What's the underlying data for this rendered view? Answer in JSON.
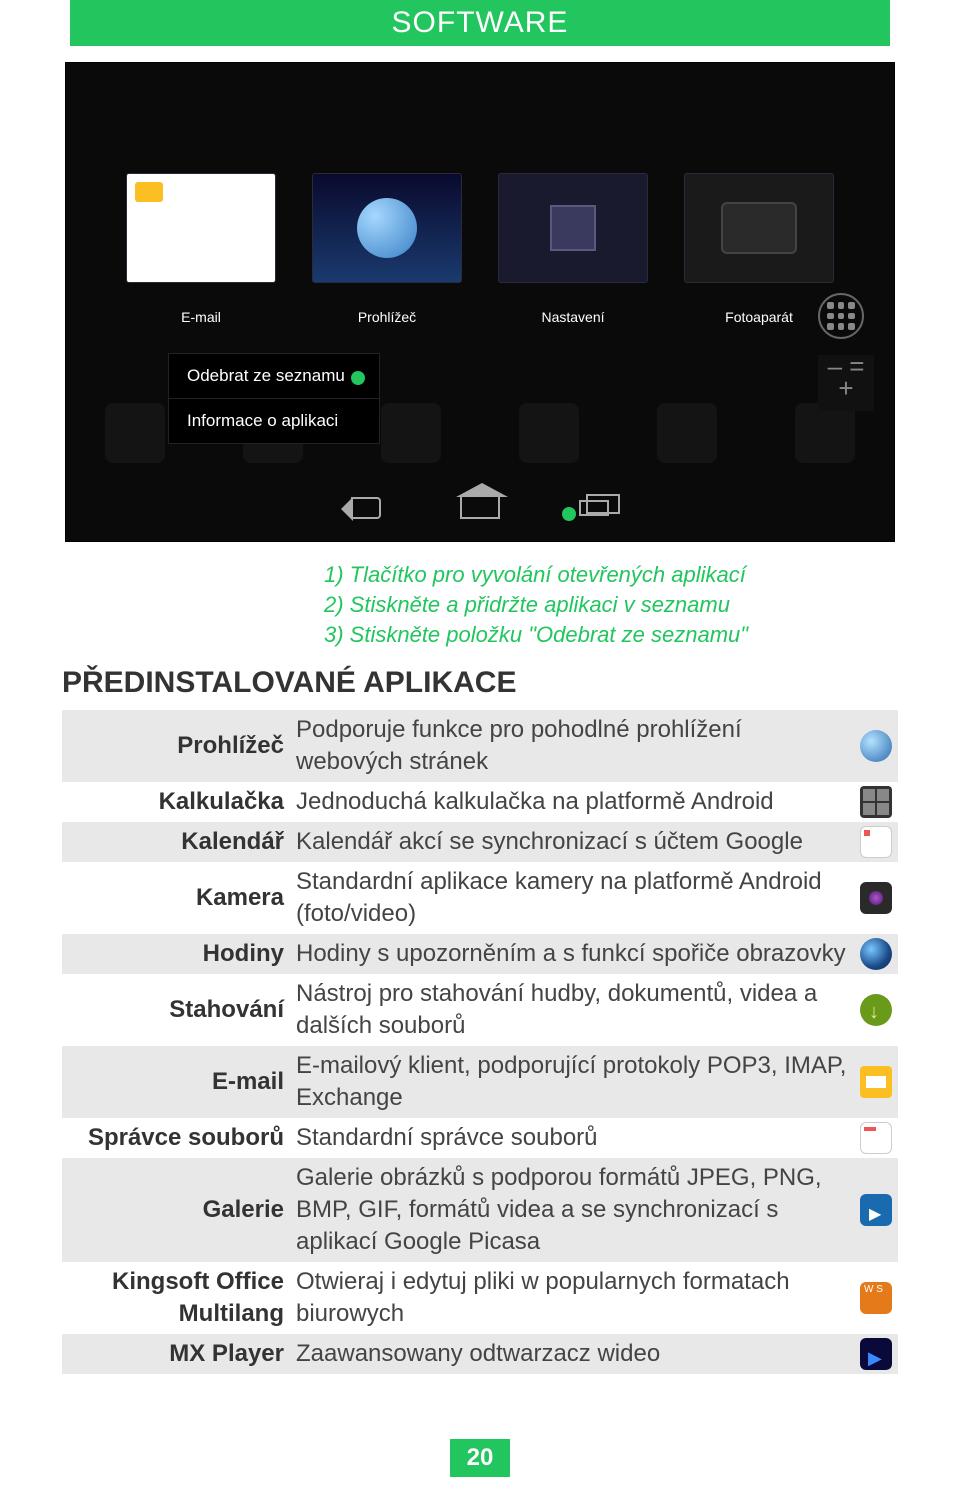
{
  "header": {
    "title": "SOFTWARE"
  },
  "screenshot": {
    "cards": [
      {
        "label": "E-mail"
      },
      {
        "label": "Prohlížeč"
      },
      {
        "label": "Nastavení"
      },
      {
        "label": "Fotoaparát"
      }
    ],
    "context_menu": {
      "remove": "Odebrat ze seznamu",
      "info": "Informace o aplikaci"
    }
  },
  "callout": {
    "line1": "1) Tlačítko pro vyvolání otevřených aplikací",
    "line2": "2) Stiskněte a přidržte aplikaci v seznamu",
    "line3": "3) Stiskněte položku \"Odebrat ze seznamu\""
  },
  "section_title": "PŘEDINSTALOVANÉ APLIKACE",
  "apps": [
    {
      "name": "Prohlížeč",
      "desc": "Podporuje funkce pro pohodlné prohlížení webových stránek",
      "icon": "m-browser",
      "shade": true
    },
    {
      "name": "Kalkulačka",
      "desc": "Jednoduchá kalkulačka na platformě Android",
      "icon": "m-calc",
      "shade": false
    },
    {
      "name": "Kalendář",
      "desc": "Kalendář akcí se synchronizací s účtem Google",
      "icon": "m-cal",
      "shade": true
    },
    {
      "name": "Kamera",
      "desc": "Standardní aplikace kamery na platformě Android (foto/video)",
      "icon": "m-cam",
      "shade": false
    },
    {
      "name": "Hodiny",
      "desc": "Hodiny s upozorněním a s funkcí spořiče obrazovky",
      "icon": "m-clock",
      "shade": true
    },
    {
      "name": "Stahování",
      "desc": "Nástroj pro stahování hudby, dokumentů, videa a dalších souborů",
      "icon": "m-dl",
      "shade": false
    },
    {
      "name": "E-mail",
      "desc": "E-mailový klient, podporující protokoly POP3, IMAP, Exchange",
      "icon": "m-mail",
      "shade": true
    },
    {
      "name": "Správce souborů",
      "desc": "Standardní správce souborů",
      "icon": "m-fm",
      "shade": false
    },
    {
      "name": "Galerie",
      "desc": "Galerie obrázků s podporou formátů JPEG, PNG, BMP, GIF, formátů videa a se synchronizací s aplikací Google Picasa",
      "icon": "m-gal",
      "shade": true
    },
    {
      "name": "Kingsoft Office Multilang",
      "desc": "Otwieraj i edytuj pliki w popularnych formatach biurowych",
      "icon": "m-ko",
      "shade": false
    },
    {
      "name": "MX Player",
      "desc": "Zaawansowany odtwarzacz wideo",
      "icon": "m-mx",
      "shade": true
    }
  ],
  "page_number": "20"
}
